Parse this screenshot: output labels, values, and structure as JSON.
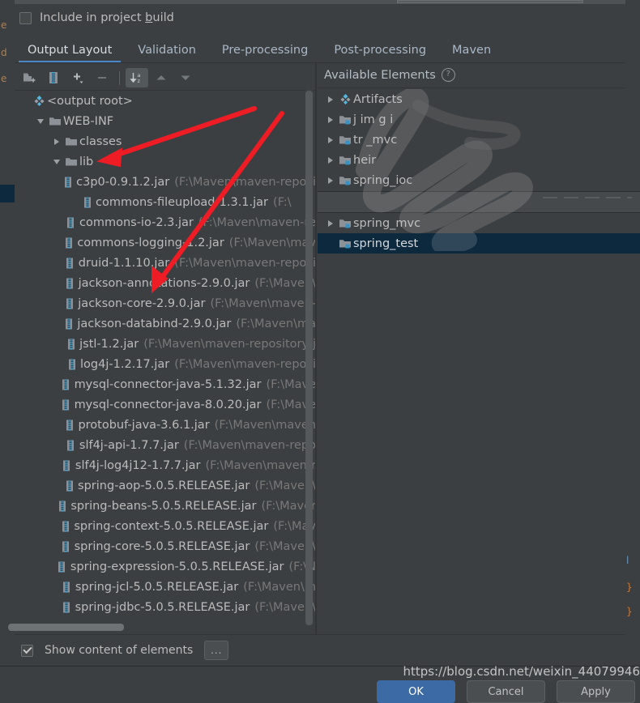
{
  "dialog": {
    "include_in_build": {
      "label_pre": "Include in project ",
      "label_mnemonic": "b",
      "label_post": "uild",
      "checked": false
    },
    "tabs": [
      {
        "label": "Output Layout",
        "active": true
      },
      {
        "label": "Validation",
        "active": false
      },
      {
        "label": "Pre-processing",
        "active": false
      },
      {
        "label": "Post-processing",
        "active": false
      },
      {
        "label": "Maven",
        "active": false
      }
    ],
    "toolbar": [
      {
        "name": "add-directory-icon",
        "title": "Create Directory"
      },
      {
        "name": "add-archive-icon",
        "title": "Create Archive"
      },
      {
        "name": "add-element-icon",
        "title": "Add Copy of"
      },
      {
        "name": "remove-element-icon",
        "title": "Remove"
      },
      {
        "name": "sort-alphabetically-icon",
        "title": "Sort by Name",
        "toggled": true
      },
      {
        "name": "move-up-icon",
        "title": "Move Up"
      },
      {
        "name": "move-down-icon",
        "title": "Move Down"
      }
    ],
    "footer": {
      "show_content_label": "Show content of elements",
      "show_content_checked": true,
      "ellipsis_button": "..."
    },
    "buttons": [
      {
        "label": "OK",
        "primary": true
      },
      {
        "label": "Cancel",
        "primary": false
      },
      {
        "label": "Apply",
        "primary": false
      }
    ]
  },
  "output_tree": [
    {
      "indent": 0,
      "twist": "none",
      "icon": "artifact-icon",
      "name": "<output root>",
      "path": ""
    },
    {
      "indent": 1,
      "twist": "down",
      "icon": "folder-icon",
      "name": "WEB-INF",
      "path": ""
    },
    {
      "indent": 2,
      "twist": "right",
      "icon": "folder-icon",
      "name": "classes",
      "path": ""
    },
    {
      "indent": 2,
      "twist": "down",
      "icon": "folder-icon",
      "name": "lib",
      "path": ""
    },
    {
      "indent": 3,
      "twist": "none",
      "icon": "jar-icon",
      "name": "c3p0-0.9.1.2.jar",
      "path": "(F:\\Maven\\maven-reposi"
    },
    {
      "indent": 3,
      "twist": "none",
      "icon": "jar-icon",
      "name": "commons-fileupload-1.3.1.jar",
      "path": "(F:\\"
    },
    {
      "indent": 3,
      "twist": "none",
      "icon": "jar-icon",
      "name": "commons-io-2.3.jar",
      "path": "(F:\\Maven\\maven-re"
    },
    {
      "indent": 3,
      "twist": "none",
      "icon": "jar-icon",
      "name": "commons-logging-1.2.jar",
      "path": "(F:\\Maven\\mav"
    },
    {
      "indent": 3,
      "twist": "none",
      "icon": "jar-icon",
      "name": "druid-1.1.10.jar",
      "path": "(F:\\Maven\\maven-reposi"
    },
    {
      "indent": 3,
      "twist": "none",
      "icon": "jar-icon",
      "name": "jackson-annotations-2.9.0.jar",
      "path": "(F:\\Maven\\"
    },
    {
      "indent": 3,
      "twist": "none",
      "icon": "jar-icon",
      "name": "jackson-core-2.9.0.jar",
      "path": "(F:\\Maven\\maven-"
    },
    {
      "indent": 3,
      "twist": "none",
      "icon": "jar-icon",
      "name": "jackson-databind-2.9.0.jar",
      "path": "(F:\\Maven\\ma"
    },
    {
      "indent": 3,
      "twist": "none",
      "icon": "jar-icon",
      "name": "jstl-1.2.jar",
      "path": "(F:\\Maven\\maven-repository\\j"
    },
    {
      "indent": 3,
      "twist": "none",
      "icon": "jar-icon",
      "name": "log4j-1.2.17.jar",
      "path": "(F:\\Maven\\maven-reposi"
    },
    {
      "indent": 3,
      "twist": "none",
      "icon": "jar-icon",
      "name": "mysql-connector-java-5.1.32.jar",
      "path": "(F:\\Mave"
    },
    {
      "indent": 3,
      "twist": "none",
      "icon": "jar-icon",
      "name": "mysql-connector-java-8.0.20.jar",
      "path": "(F:\\Mave"
    },
    {
      "indent": 3,
      "twist": "none",
      "icon": "jar-icon",
      "name": "protobuf-java-3.6.1.jar",
      "path": "(F:\\Maven\\maven"
    },
    {
      "indent": 3,
      "twist": "none",
      "icon": "jar-icon",
      "name": "slf4j-api-1.7.7.jar",
      "path": "(F:\\Maven\\maven-repo"
    },
    {
      "indent": 3,
      "twist": "none",
      "icon": "jar-icon",
      "name": "slf4j-log4j12-1.7.7.jar",
      "path": "(F:\\Maven\\maven-r"
    },
    {
      "indent": 3,
      "twist": "none",
      "icon": "jar-icon",
      "name": "spring-aop-5.0.5.RELEASE.jar",
      "path": "(F:\\Maven\\"
    },
    {
      "indent": 3,
      "twist": "none",
      "icon": "jar-icon",
      "name": "spring-beans-5.0.5.RELEASE.jar",
      "path": "(F:\\Maver"
    },
    {
      "indent": 3,
      "twist": "none",
      "icon": "jar-icon",
      "name": "spring-context-5.0.5.RELEASE.jar",
      "path": "(F:\\Mav"
    },
    {
      "indent": 3,
      "twist": "none",
      "icon": "jar-icon",
      "name": "spring-core-5.0.5.RELEASE.jar",
      "path": "(F:\\Maven\\"
    },
    {
      "indent": 3,
      "twist": "none",
      "icon": "jar-icon",
      "name": "spring-expression-5.0.5.RELEASE.jar",
      "path": "(F:\\N"
    },
    {
      "indent": 3,
      "twist": "none",
      "icon": "jar-icon",
      "name": "spring-jcl-5.0.5.RELEASE.jar",
      "path": "(F:\\Maven\\m"
    },
    {
      "indent": 3,
      "twist": "none",
      "icon": "jar-icon",
      "name": "spring-jdbc-5.0.5.RELEASE.jar",
      "path": "(F:\\Maven\\"
    }
  ],
  "available_elements": {
    "title": "Available Elements",
    "help_icon": "?",
    "items": [
      {
        "twist": "right",
        "icon": "artifact-icon",
        "name": "Artifacts",
        "obscured": false,
        "selected": false
      },
      {
        "twist": "right",
        "icon": "module-icon",
        "name": "j    im          g i",
        "obscured": true,
        "selected": false
      },
      {
        "twist": "right",
        "icon": "module-icon",
        "name": "tr                 _mvc",
        "obscured": true,
        "selected": false
      },
      {
        "twist": "right",
        "icon": "module-icon",
        "name": "   heir",
        "obscured": true,
        "selected": false
      },
      {
        "twist": "right",
        "icon": "module-icon",
        "name": "spring_ioc",
        "obscured": false,
        "selected": false
      }
    ],
    "items_below_seam": [
      {
        "twist": "right",
        "icon": "module-icon",
        "name": "spring_mvc",
        "selected": false
      },
      {
        "twist": "none",
        "icon": "module-icon",
        "name": "spring_test",
        "selected": true
      }
    ]
  },
  "annotations": {
    "arrows": [
      {
        "name": "red-arrow-to-lib",
        "color": "#ee1c24"
      },
      {
        "name": "red-arrow-to-jackson-annotations",
        "color": "#ee1c24"
      }
    ],
    "scribble": {
      "name": "white-marker-scribble",
      "color": "#e8e8e8"
    }
  },
  "watermark": {
    "text": "https://blog.csdn.net/weixin_44079946"
  },
  "background_editor": {
    "left_gutter_chars": [
      "e",
      "d",
      "e"
    ],
    "right_code_chars": [
      "}",
      "}"
    ]
  },
  "colors": {
    "background": "#3c3f41",
    "selection": "#0d293e",
    "accent": "#4a88c7",
    "annotation_red": "#ee1c24",
    "text": "#bbbbbb",
    "path_text": "#787878"
  }
}
